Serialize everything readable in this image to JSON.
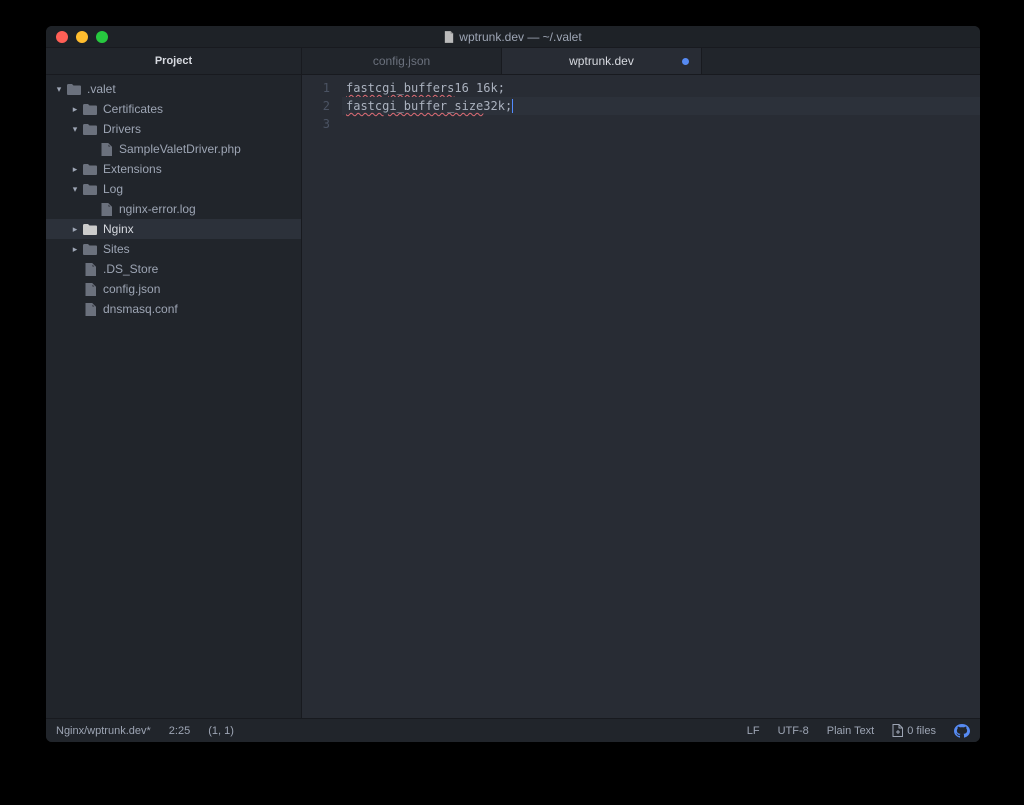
{
  "window": {
    "title": "wptrunk.dev — ~/.valet"
  },
  "sidebar": {
    "header": "Project",
    "tree": {
      "root": ".valet",
      "certificates": "Certificates",
      "drivers": "Drivers",
      "drivers_file": "SampleValetDriver.php",
      "extensions": "Extensions",
      "log": "Log",
      "log_file": "nginx-error.log",
      "nginx": "Nginx",
      "sites": "Sites",
      "dsstore": ".DS_Store",
      "configjson": "config.json",
      "dnsmasq": "dnsmasq.conf"
    }
  },
  "tabs": {
    "tab1": "config.json",
    "tab2": "wptrunk.dev"
  },
  "editor": {
    "lines": {
      "l1_kw": "fastcgi_buffers",
      "l1_rest": " 16 16k;",
      "l2_kw": "fastcgi_buffer_size",
      "l2_rest": " 32k;"
    },
    "gutter": {
      "n1": "1",
      "n2": "2",
      "n3": "3"
    }
  },
  "status": {
    "path": "Nginx/wptrunk.dev*",
    "lincol": "2:25",
    "pos": "(1, 1)",
    "lf": "LF",
    "enc": "UTF-8",
    "lang": "Plain Text",
    "files": "0 files"
  }
}
